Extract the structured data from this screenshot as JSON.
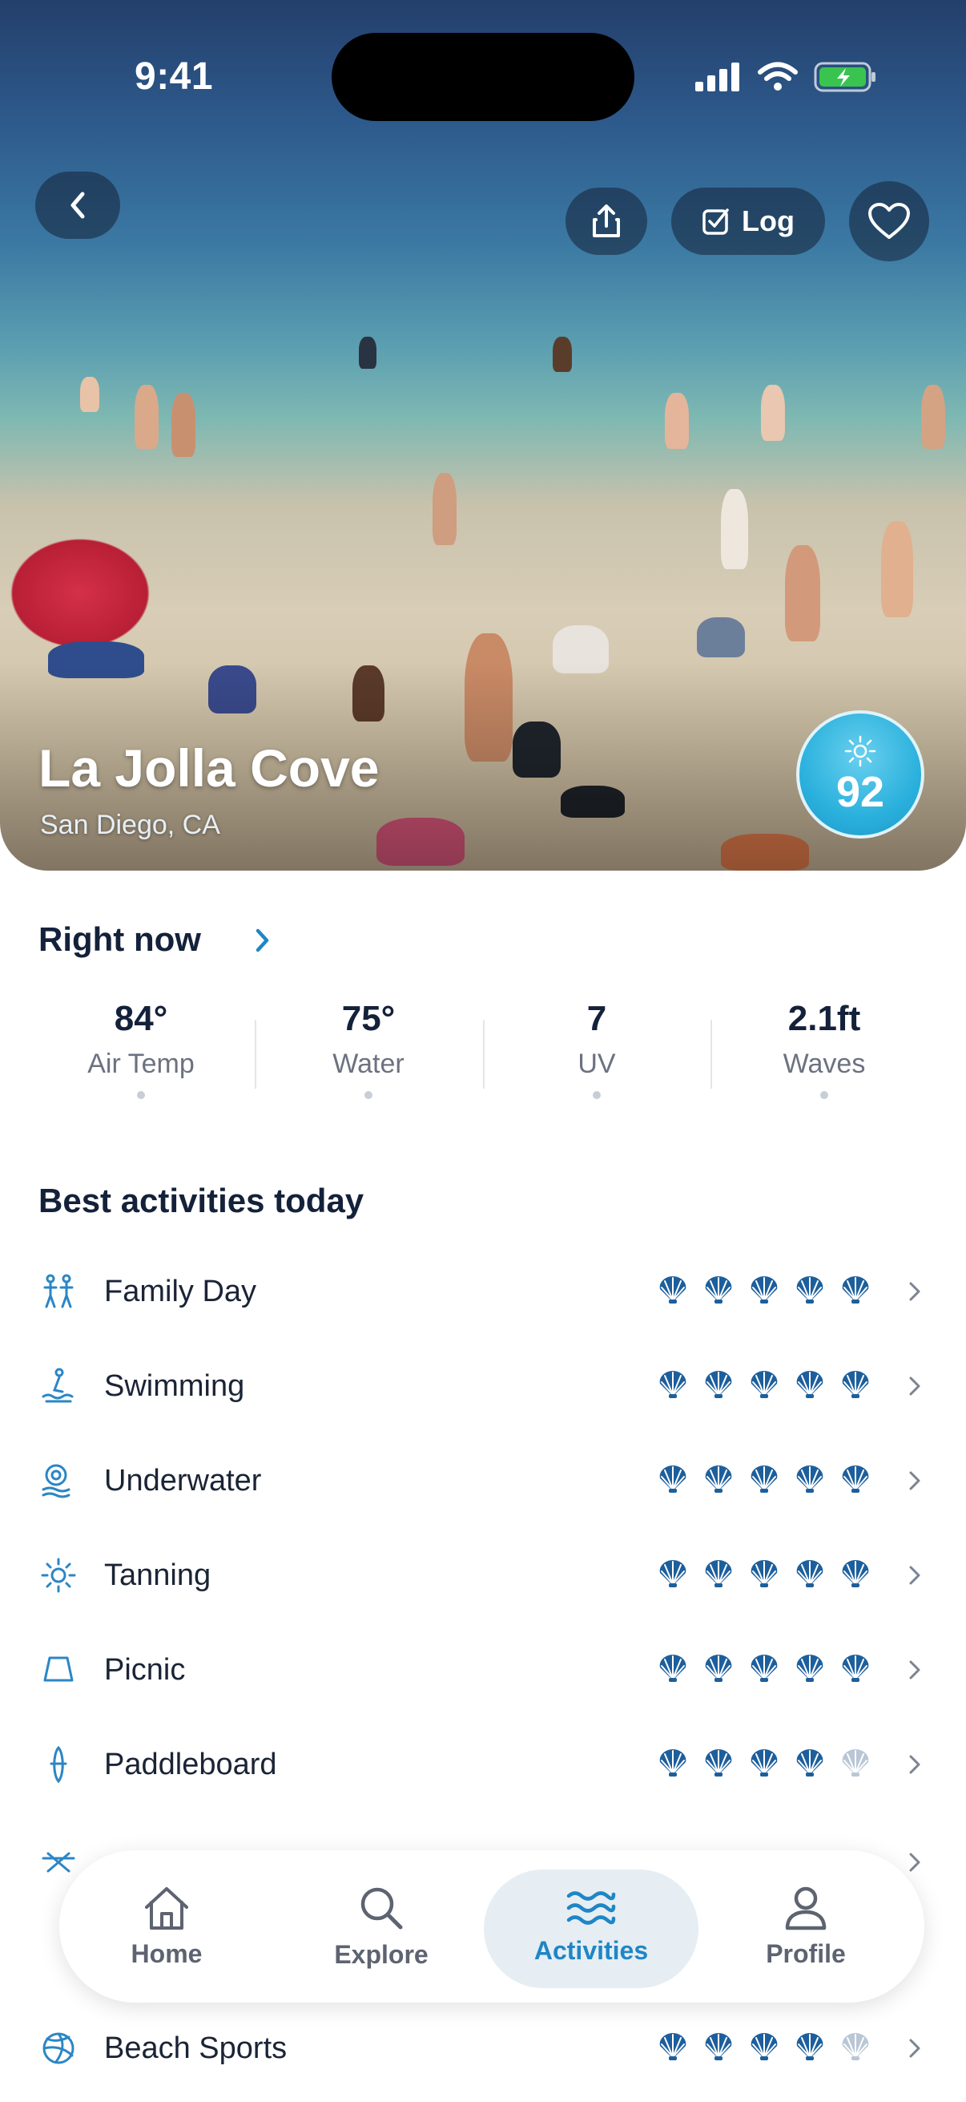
{
  "status": {
    "time": "9:41"
  },
  "hero": {
    "name": "La Jolla Cove",
    "location": "San Diego, CA",
    "score": "92",
    "log_label": "Log"
  },
  "right_now": {
    "title": "Right now",
    "stats": [
      {
        "value": "84°",
        "label": "Air Temp"
      },
      {
        "value": "75°",
        "label": "Water"
      },
      {
        "value": "7",
        "label": "UV"
      },
      {
        "value": "2.1ft",
        "label": "Waves"
      }
    ]
  },
  "activities": {
    "title": "Best activities today",
    "items": [
      {
        "label": "Family Day",
        "icon": "family-icon",
        "rating": 5
      },
      {
        "label": "Swimming",
        "icon": "swimming-icon",
        "rating": 5
      },
      {
        "label": "Underwater",
        "icon": "snorkel-icon",
        "rating": 5
      },
      {
        "label": "Tanning",
        "icon": "sun-icon",
        "rating": 5
      },
      {
        "label": "Picnic",
        "icon": "picnic-icon",
        "rating": 5
      },
      {
        "label": "Paddleboard",
        "icon": "paddleboard-icon",
        "rating": 4
      },
      {
        "label": "Beach Sports",
        "icon": "volleyball-icon",
        "rating": 4
      }
    ]
  },
  "tabs": [
    {
      "label": "Home",
      "icon": "home-icon"
    },
    {
      "label": "Explore",
      "icon": "search-icon"
    },
    {
      "label": "Activities",
      "icon": "waves-icon",
      "active": true
    },
    {
      "label": "Profile",
      "icon": "profile-icon"
    }
  ],
  "colors": {
    "accent": "#1f86c6",
    "shell_on": "#1d5f9c",
    "shell_off": "#b9c6d6",
    "score_badge": "#2bb1dd"
  }
}
